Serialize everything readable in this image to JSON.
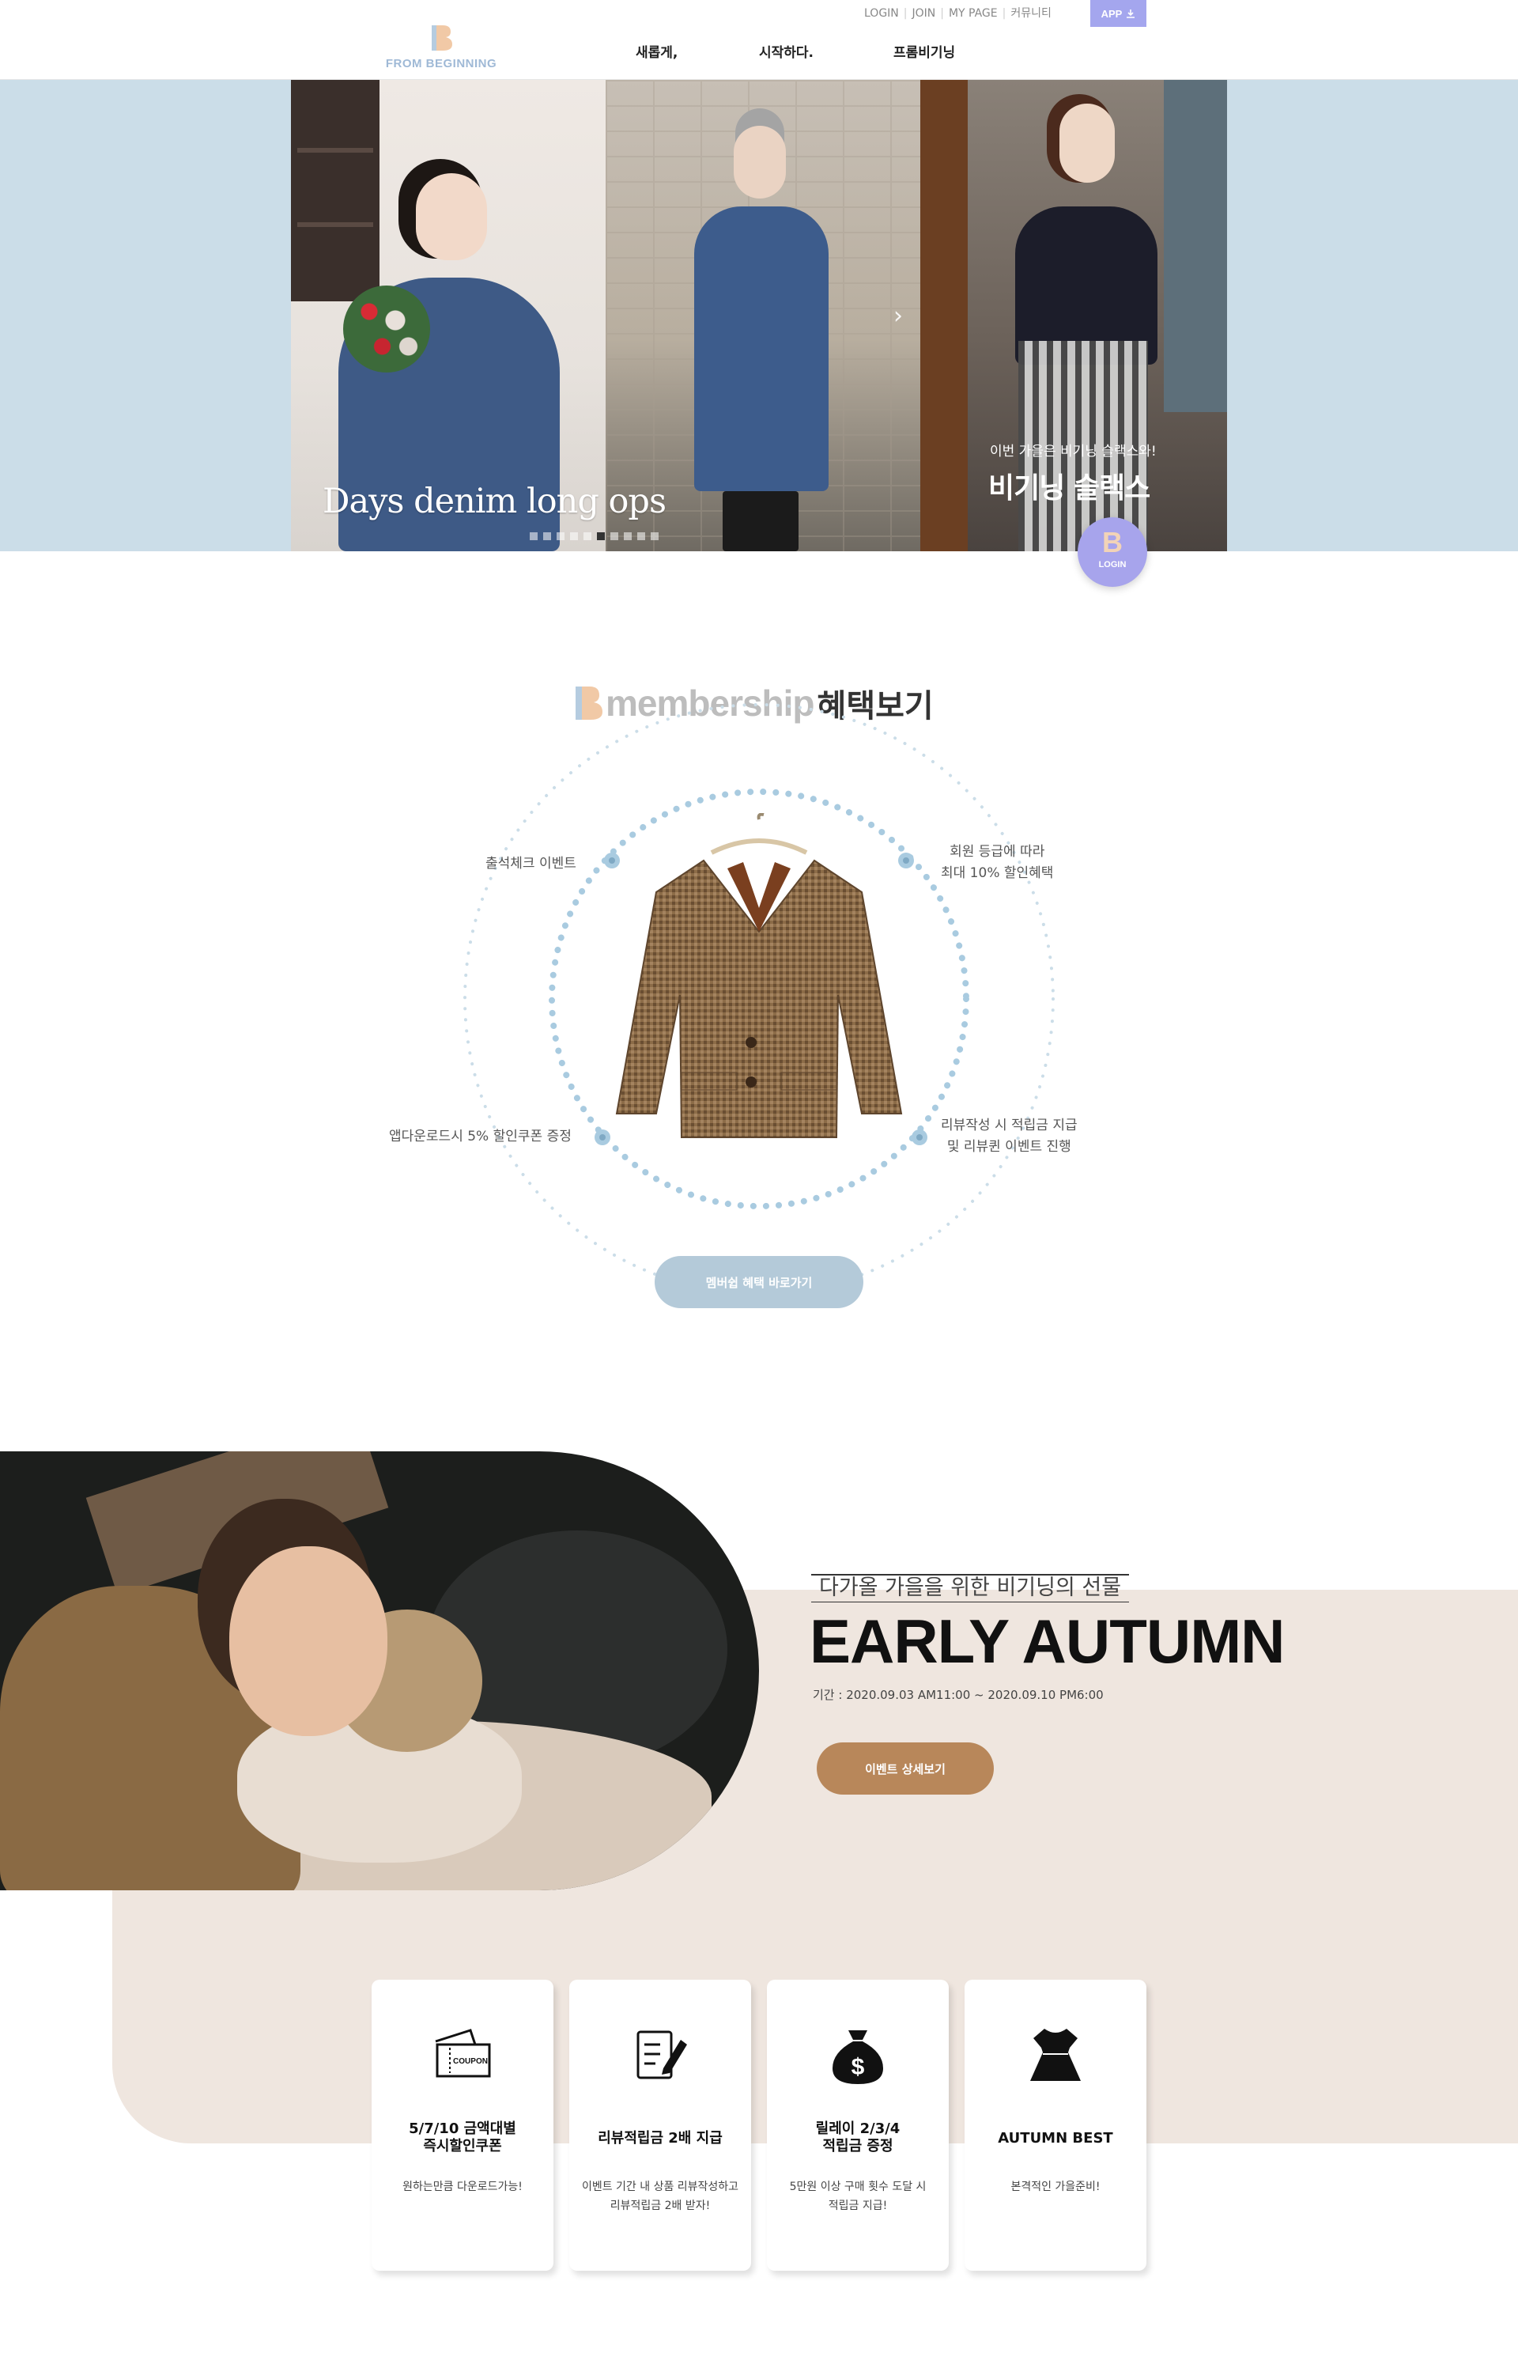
{
  "header": {
    "logo_text": "FROM BEGINNING",
    "nav": [
      "새롭게,",
      "시작하다.",
      "프롬비기닝"
    ],
    "util": [
      "LOGIN",
      "JOIN",
      "MY PAGE",
      "커뮤니티"
    ],
    "app_label": "APP"
  },
  "hero": {
    "title": "Days denim long ops",
    "caption_small": "이번 가을은 비기닝 슬랙스와!",
    "caption_big": "비기닝 슬랙스",
    "slide_count": 10,
    "active_slide": 5,
    "login_badge": "LOGIN"
  },
  "membership": {
    "title_word": "membership",
    "title_ko": "혜택보기",
    "benefits": {
      "attendance": "출석체크 이벤트",
      "grade_line1": "회원 등급에 따라",
      "grade_line2": "최대 10% 할인혜택",
      "app_coupon": "앱다운로드시 5% 할인쿠폰 증정",
      "review_line1": "리뷰작성 시 적립금 지급",
      "review_line2": "및 리뷰퀸 이벤트 진행"
    },
    "button": "멤버쉽 혜택 바로가기"
  },
  "autumn": {
    "subtitle": "다가올 가을을 위한 비기닝의 선물",
    "title": "EARLY AUTUMN",
    "period": "기간 : 2020.09.03 AM11:00 ~ 2020.09.10 PM6:00",
    "button": "이벤트 상세보기",
    "cards": [
      {
        "title_line1": "5/7/10 금액대별",
        "title_line2": "즉시할인쿠폰",
        "desc_line1": "원하는만큼 다운로드가능!",
        "desc_line2": "",
        "icon": "coupon-icon",
        "coupon_text": "COUPON"
      },
      {
        "title_line1": "리뷰적립금 2배 지급",
        "title_line2": "",
        "desc_line1": "이벤트 기간 내 상품 리뷰작성하고",
        "desc_line2": "리뷰적립금 2배 받자!",
        "icon": "review-icon"
      },
      {
        "title_line1": "릴레이 2/3/4",
        "title_line2": "적립금 증정",
        "desc_line1": "5만원 이상 구매 횟수 도달 시",
        "desc_line2": "적립금 지급!",
        "icon": "money-bag-icon"
      },
      {
        "title_line1": "AUTUMN BEST",
        "title_line2": "",
        "desc_line1": "본격적인 가을준비!",
        "desc_line2": "",
        "icon": "dress-icon"
      }
    ]
  },
  "colors": {
    "hero_bg": "#cbdde8",
    "accent_purple": "#a4a6ee",
    "membership_button": "#b4cad9",
    "autumn_button": "#b8875a",
    "beige": "#efe6df",
    "dot_blue": "#a9cbe0"
  }
}
